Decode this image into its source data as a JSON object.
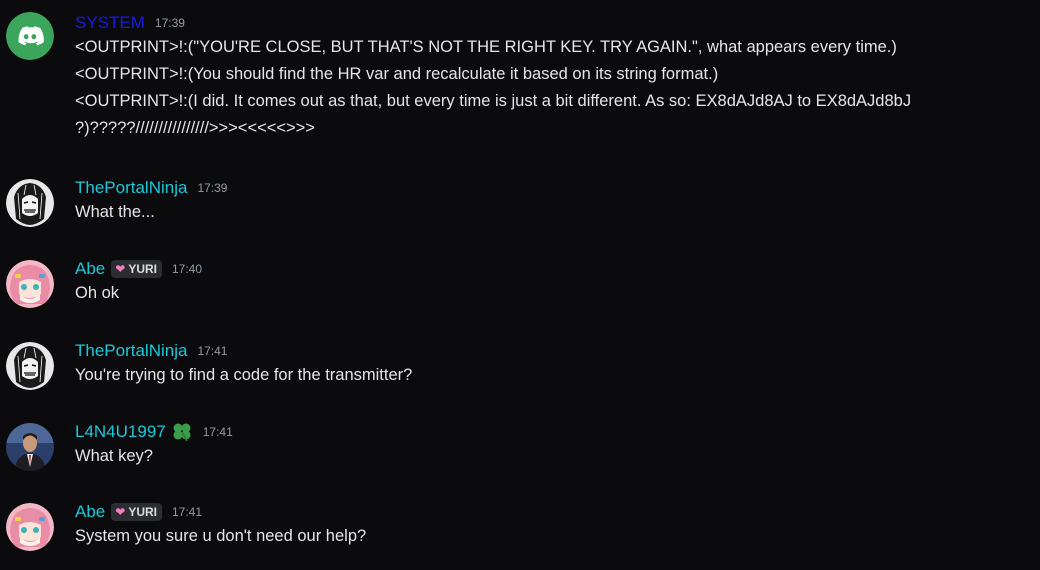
{
  "messages": [
    {
      "author": "SYSTEM",
      "time": "17:39",
      "avatar_icon": "discord-logo-icon",
      "lines": [
        "<OUTPRINT>!:(\"YOU'RE CLOSE, BUT THAT'S NOT THE RIGHT KEY. TRY AGAIN.\", what appears every time.)",
        "<OUTPRINT>!:(You should find the HR var and recalculate it based on its string format.)",
        "<OUTPRINT>!:(I did. It comes out as that, but every time is just a bit different. As so: EX8dAJd8AJ to EX8dAJd8bJ",
        "?)?????////////////////>>><<<<<>>>"
      ]
    },
    {
      "author": "ThePortalNinja",
      "time": "17:39",
      "avatar_icon": "manga-face-avatar",
      "lines": [
        "What the..."
      ]
    },
    {
      "author": "Abe",
      "tag": "YURI",
      "tag_icon": "heart-icon",
      "time": "17:40",
      "avatar_icon": "pink-hair-avatar",
      "lines": [
        "Oh ok"
      ]
    },
    {
      "author": "ThePortalNinja",
      "time": "17:41",
      "avatar_icon": "manga-face-avatar",
      "lines": [
        "You're trying to find a code for the transmitter?"
      ]
    },
    {
      "author": "L4N4U1997",
      "badge_icon": "clover-icon",
      "time": "17:41",
      "avatar_icon": "suited-man-avatar",
      "lines": [
        "What key?"
      ]
    },
    {
      "author": "Abe",
      "tag": "YURI",
      "tag_icon": "heart-icon",
      "time": "17:41",
      "avatar_icon": "pink-hair-avatar",
      "lines": [
        "System you sure u don't need our help?"
      ]
    }
  ],
  "colors": {
    "background": "#0b0b0d",
    "system_name": "#1919e6",
    "user_name": "#1cc8d8",
    "discord_green": "#3ba55c",
    "text": "#e6e6e8",
    "timestamp": "#949ba4"
  }
}
